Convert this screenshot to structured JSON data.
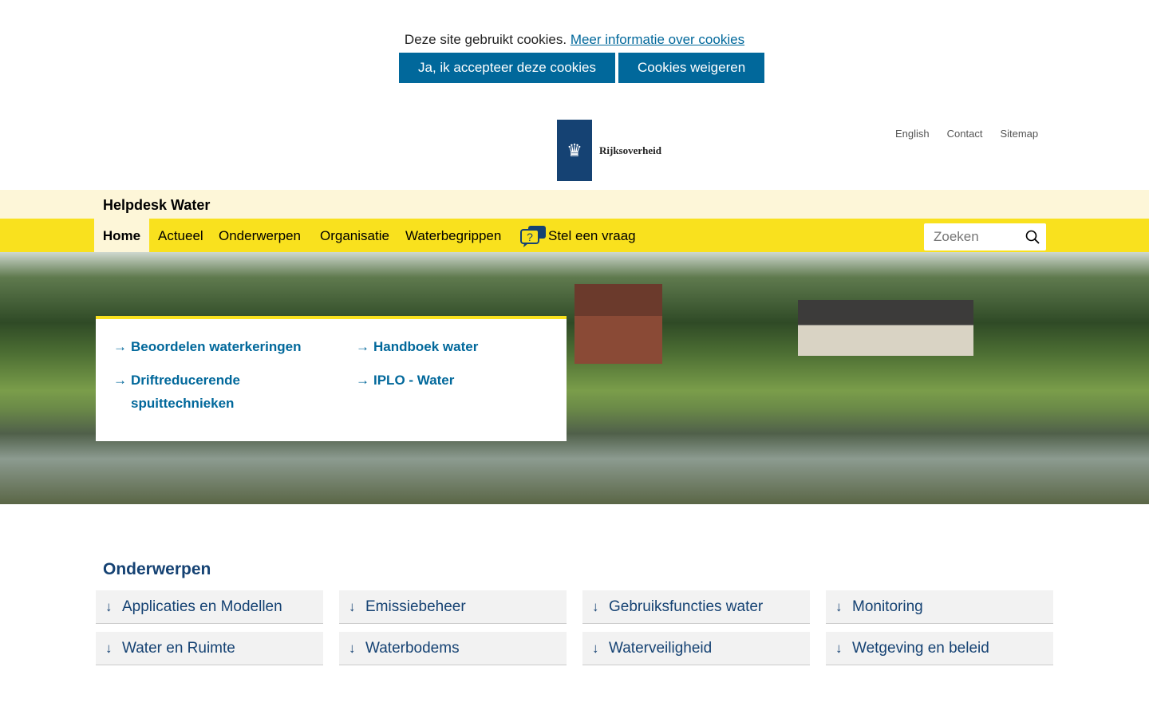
{
  "cookie": {
    "text": "Deze site gebruikt cookies.",
    "link": "Meer informatie over cookies",
    "accept": "Ja, ik accepteer deze cookies",
    "reject": "Cookies weigeren"
  },
  "logo": {
    "text": "Rijksoverheid"
  },
  "top_links": [
    "English",
    "Contact",
    "Sitemap"
  ],
  "site_title": "Helpdesk Water",
  "nav": {
    "items": [
      "Home",
      "Actueel",
      "Onderwerpen",
      "Organisatie",
      "Waterbegrippen",
      "Stel een vraag"
    ],
    "search_placeholder": "Zoeken"
  },
  "quick_links": [
    "Beoordelen waterkeringen",
    "Handboek water",
    "Driftreducerende spuittechnieken",
    "IPLO - Water"
  ],
  "topics": {
    "title": "Onderwerpen",
    "items": [
      "Applicaties en Modellen",
      "Emissiebeheer",
      "Gebruiksfuncties water",
      "Monitoring",
      "Water en Ruimte",
      "Waterbodems",
      "Waterveiligheid",
      "Wetgeving en beleid"
    ]
  }
}
